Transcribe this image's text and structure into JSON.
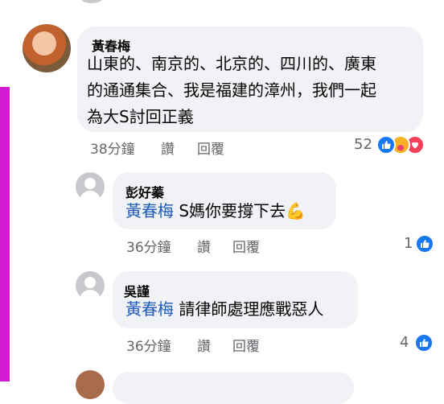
{
  "comment": {
    "author": "黃春梅",
    "lines": [
      "山東的、南京的、北京的、四川的、廣東",
      "的通通集合、我是福建的漳州，我們一起",
      "為大S討回正義"
    ],
    "time": "38分鐘",
    "like_label": "讚",
    "reply_label": "回覆",
    "reaction_count": "52",
    "reaction_icons": [
      "like-icon",
      "care-icon",
      "heart-icon"
    ]
  },
  "replies": [
    {
      "author": "彭好蓁",
      "mention": "黃春梅",
      "text": "S媽你要撐下去",
      "emoji": "💪",
      "time": "36分鐘",
      "like_label": "讚",
      "reply_label": "回覆",
      "reaction_count": "1"
    },
    {
      "author": "吳謹",
      "mention": "黃春梅",
      "text": "請律師處理應戰惡人",
      "time": "36分鐘",
      "like_label": "讚",
      "reply_label": "回覆",
      "reaction_count": "4"
    }
  ],
  "colors": {
    "mention": "#1d5ab8",
    "like": "#1877f2",
    "bubble": "#f0f2f5",
    "side_stripe": "#d21bd2"
  }
}
